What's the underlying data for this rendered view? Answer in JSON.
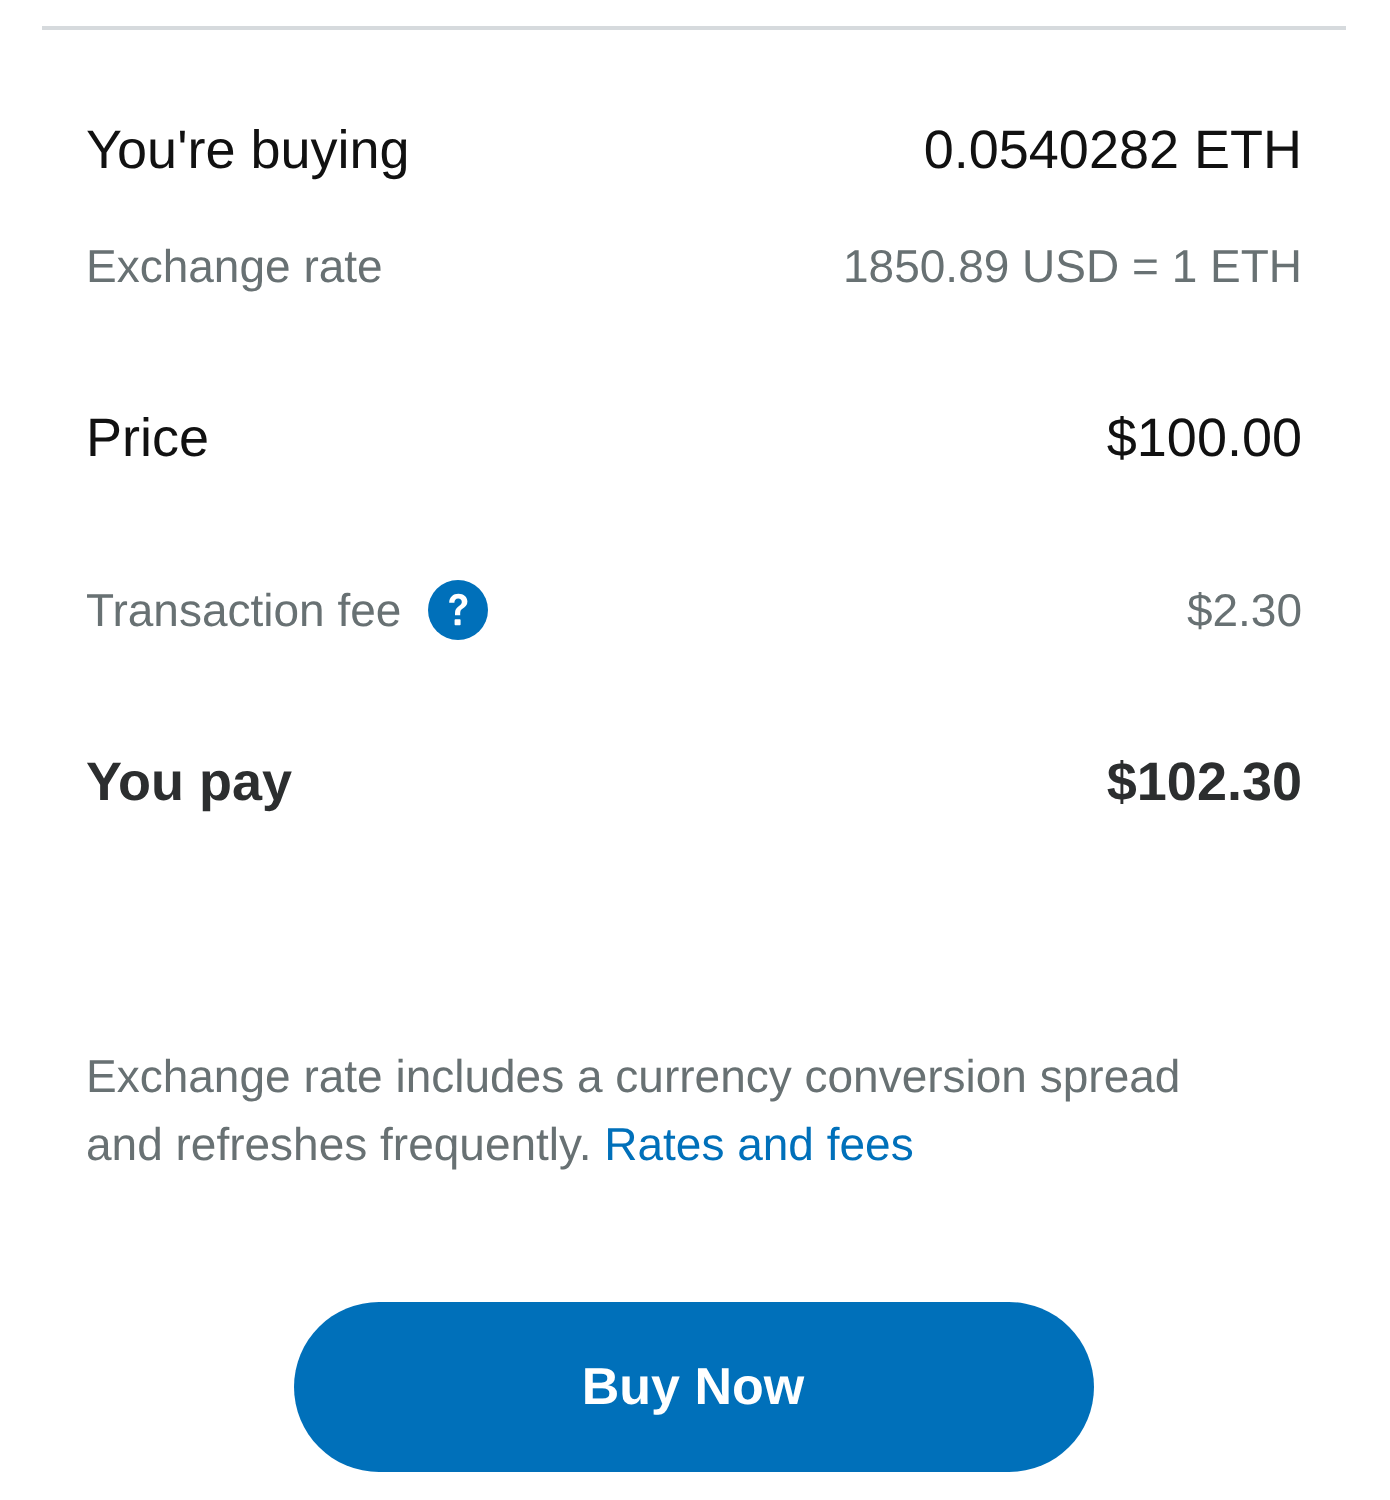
{
  "rows": [
    {
      "kind": "primary",
      "label": "You're buying",
      "value": "0.0540282 ETH",
      "help": false,
      "detail": {
        "label": "Exchange rate",
        "value": "1850.89 USD = 1 ETH"
      }
    },
    {
      "kind": "primary",
      "label": "Price",
      "value": "$100.00",
      "help": false
    },
    {
      "kind": "secondary",
      "label": "Transaction fee",
      "value": "$2.30",
      "help": true
    },
    {
      "kind": "total",
      "label": "You pay",
      "value": "$102.30",
      "help": false
    }
  ],
  "disclaimer": {
    "text": "Exchange rate includes a currency conversion spread and refreshes frequently.",
    "link": "Rates and fees"
  },
  "button": {
    "label": "Buy Now"
  }
}
